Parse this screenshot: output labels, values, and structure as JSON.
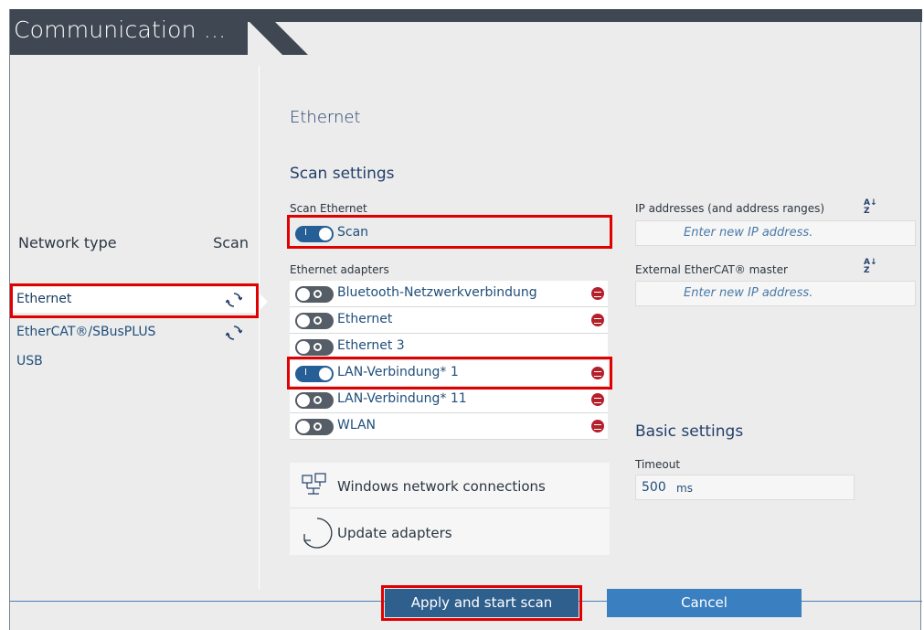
{
  "window": {
    "title": "Communication ..."
  },
  "network": {
    "header_label": "Network type",
    "header_scan": "Scan",
    "items": [
      {
        "label": "Ethernet",
        "selected": true,
        "icon": "refresh-icon"
      },
      {
        "label": "EtherCAT®/SBusPLUS",
        "selected": false,
        "icon": "refresh-icon"
      },
      {
        "label": "USB",
        "selected": false,
        "icon": ""
      }
    ]
  },
  "ethernet": {
    "heading": "Ethernet",
    "scan_settings_heading": "Scan settings",
    "scan_ethernet_label": "Scan Ethernet",
    "scan_toggle": {
      "label": "Scan",
      "on": true
    },
    "adapters_label": "Ethernet adapters",
    "adapters": [
      {
        "name": "Bluetooth-Netzwerkverbindung",
        "on": false,
        "pinned": true
      },
      {
        "name": "Ethernet",
        "on": false,
        "pinned": true
      },
      {
        "name": "Ethernet 3",
        "on": false,
        "pinned": false
      },
      {
        "name": "LAN-Verbindung* 1",
        "on": true,
        "pinned": true
      },
      {
        "name": "LAN-Verbindung* 11",
        "on": false,
        "pinned": true
      },
      {
        "name": "WLAN",
        "on": false,
        "pinned": true
      }
    ],
    "actions": {
      "windows_network": "Windows network connections",
      "update_adapters": "Update adapters"
    }
  },
  "ip": {
    "addresses_label": "IP addresses (and address ranges)",
    "addresses_placeholder": "Enter new IP address.",
    "ext_master_label": "External EtherCAT® master",
    "ext_master_placeholder": "Enter new IP address.",
    "sort_icon": "sort-az-icon"
  },
  "basic": {
    "heading": "Basic settings",
    "timeout_label": "Timeout",
    "timeout_value": "500",
    "timeout_unit": "ms"
  },
  "buttons": {
    "apply": "Apply and start scan",
    "cancel": "Cancel"
  },
  "colors": {
    "accent": "#255f95",
    "title_bar": "#3e4752",
    "highlight": "#e00000",
    "pin": "#b3202a"
  }
}
